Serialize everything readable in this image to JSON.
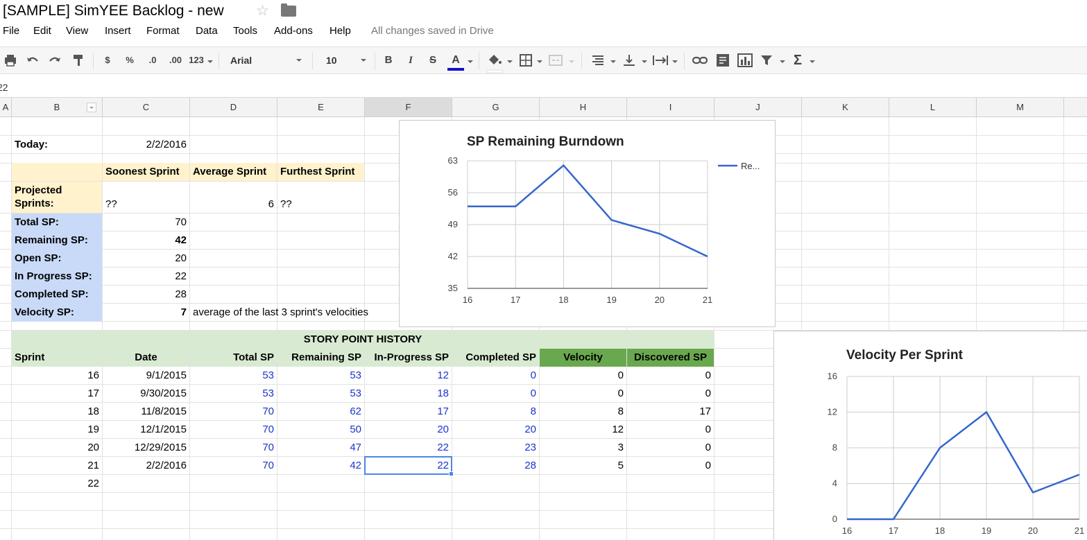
{
  "title": "[SAMPLE] SimYEE Backlog - new",
  "menu": [
    "File",
    "Edit",
    "View",
    "Insert",
    "Format",
    "Data",
    "Tools",
    "Add-ons",
    "Help"
  ],
  "save_status": "All changes saved in Drive",
  "toolbar": {
    "currency": "$",
    "percent": "%",
    "dec_decrease": ".0",
    "dec_increase": ".00",
    "more_formats": "123",
    "font": "Arial",
    "font_size": "10",
    "bold": "B",
    "italic": "I",
    "strike": "S",
    "text_color": "A",
    "functions": "Σ"
  },
  "cell_ref": "22",
  "columns": [
    "A",
    "B",
    "C",
    "D",
    "E",
    "F",
    "G",
    "H",
    "I",
    "J",
    "K",
    "L",
    "M"
  ],
  "summary": {
    "today_label": "Today:",
    "today_value": "2/2/2016",
    "headers": [
      "Soonest Sprint",
      "Average Sprint",
      "Furthest Sprint"
    ],
    "projected_label_1": "Projected",
    "projected_label_2": "Sprints:",
    "projected_soonest": "??",
    "projected_average": "6",
    "projected_furthest": "??",
    "rows": [
      {
        "label": "Total SP:",
        "value": "70"
      },
      {
        "label": "Remaining SP:",
        "value": "42"
      },
      {
        "label": "Open SP:",
        "value": "20"
      },
      {
        "label": "In Progress SP:",
        "value": "22"
      },
      {
        "label": "Completed SP:",
        "value": "28"
      },
      {
        "label": "Velocity SP:",
        "value": "7"
      }
    ],
    "velocity_note": "average of the last 3 sprint's velocities"
  },
  "history": {
    "title": "STORY POINT HISTORY",
    "headers": [
      "Sprint",
      "Date",
      "Total SP",
      "Remaining SP",
      "In-Progress SP",
      "Completed SP",
      "Velocity",
      "Discovered SP"
    ],
    "rows": [
      [
        "16",
        "9/1/2015",
        "53",
        "53",
        "12",
        "0",
        "0",
        "0"
      ],
      [
        "17",
        "9/30/2015",
        "53",
        "53",
        "18",
        "0",
        "0",
        "0"
      ],
      [
        "18",
        "11/8/2015",
        "70",
        "62",
        "17",
        "8",
        "8",
        "17"
      ],
      [
        "19",
        "12/1/2015",
        "70",
        "50",
        "20",
        "20",
        "12",
        "0"
      ],
      [
        "20",
        "12/29/2015",
        "70",
        "47",
        "22",
        "23",
        "3",
        "0"
      ],
      [
        "21",
        "2/2/2016",
        "70",
        "42",
        "22",
        "28",
        "5",
        "0"
      ],
      [
        "22",
        "",
        "",
        "",
        "",
        "",
        "",
        ""
      ]
    ]
  },
  "colors": {
    "line": "#3366cc",
    "header_yellow": "#fff2cc",
    "label_blue": "#c9daf8",
    "history_green": "#d9ead3",
    "velocity_green": "#6aa84f",
    "value_blue": "#1a33cc"
  },
  "chart_data": [
    {
      "type": "line",
      "title": "SP Remaining Burndown",
      "x": [
        16,
        17,
        18,
        19,
        20,
        21
      ],
      "series": [
        {
          "name": "Re...",
          "values": [
            53,
            53,
            62,
            50,
            47,
            42
          ]
        }
      ],
      "ylim": [
        35,
        63
      ],
      "yticks": [
        35,
        42,
        49,
        56,
        63
      ],
      "legend": "right",
      "grid": true
    },
    {
      "type": "line",
      "title": "Velocity Per Sprint",
      "x": [
        16,
        17,
        18,
        19,
        20,
        21
      ],
      "series": [
        {
          "values": [
            0,
            0,
            8,
            12,
            3,
            5
          ]
        }
      ],
      "ylim": [
        0,
        16
      ],
      "yticks": [
        0,
        4,
        8,
        12,
        16
      ],
      "grid": true
    }
  ]
}
